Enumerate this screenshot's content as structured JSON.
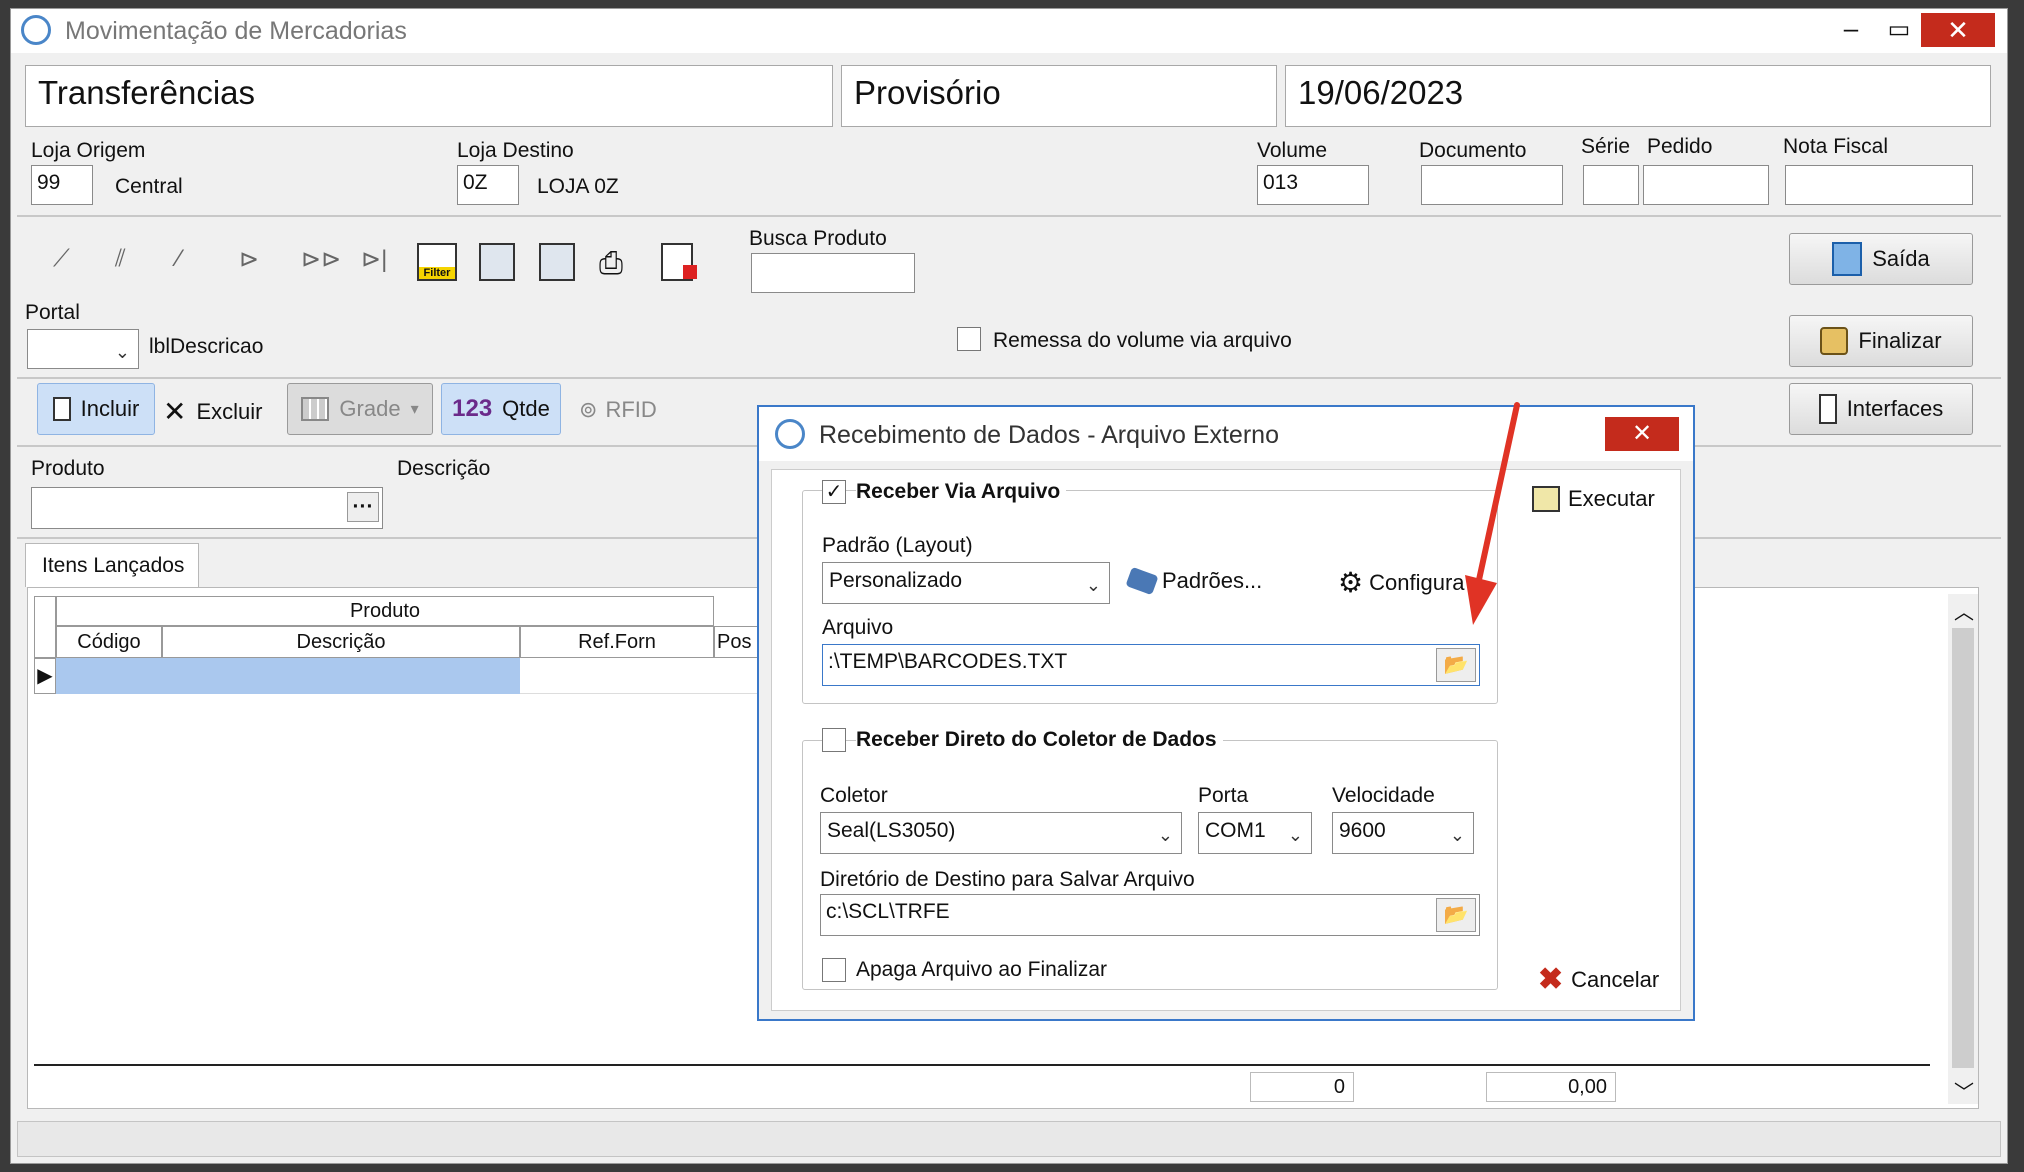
{
  "window": {
    "title": "Movimentação de Mercadorias"
  },
  "header": {
    "type": "Transferências",
    "status": "Provisório",
    "date": "19/06/2023"
  },
  "fields": {
    "loja_origem_label": "Loja Origem",
    "loja_origem_code": "99",
    "loja_origem_name": "Central",
    "loja_destino_label": "Loja Destino",
    "loja_destino_code": "0Z",
    "loja_destino_name": "LOJA 0Z",
    "volume_label": "Volume",
    "volume_value": "013",
    "documento_label": "Documento",
    "serie_label": "Série",
    "pedido_label": "Pedido",
    "nota_fiscal_label": "Nota Fiscal"
  },
  "toolbar": {
    "busca_label": "Busca Produto",
    "filter_text": "Filter"
  },
  "portal": {
    "label": "Portal",
    "descricao": "lblDescricao",
    "remessa_label": "Remessa do volume via arquivo"
  },
  "buttons": {
    "saida": "Saída",
    "finalizar": "Finalizar",
    "interfaces": "Interfaces"
  },
  "actions": {
    "incluir": "Incluir",
    "excluir": "Excluir",
    "grade": "Grade",
    "qtde_num": "123",
    "qtde": "Qtde",
    "rfid": "RFID"
  },
  "produto": {
    "label": "Produto",
    "descricao_label": "Descrição",
    "ellipsis": "···"
  },
  "tab": {
    "label": "Itens Lançados"
  },
  "grid": {
    "group_header": "Produto",
    "columns": [
      "Código",
      "Descrição",
      "Ref.Forn",
      "Pos"
    ],
    "footer_count": "0",
    "footer_total": "0,00"
  },
  "dialog": {
    "title": "Recebimento de Dados - Arquivo Externo",
    "receber_arquivo": "Receber Via Arquivo",
    "padrao_label": "Padrão (Layout)",
    "padrao_value": "Personalizado",
    "padroes_button": "Padrões...",
    "configura_button": "Configura",
    "arquivo_label": "Arquivo",
    "arquivo_value": ":\\TEMP\\BARCODES.TXT",
    "receber_coletor": "Receber Direto do Coletor de Dados",
    "coletor_label": "Coletor",
    "coletor_value": "Seal(LS3050)",
    "porta_label": "Porta",
    "porta_value": "COM1",
    "velocidade_label": "Velocidade",
    "velocidade_value": "9600",
    "diretorio_label": "Diretório de Destino para Salvar Arquivo",
    "diretorio_value": "c:\\SCL\\TRFE",
    "apaga_label": "Apaga Arquivo ao Finalizar",
    "executar": "Executar",
    "cancelar": "Cancelar"
  },
  "colors": {
    "accent": "#3a78c9",
    "close_red": "#c42b1c",
    "selection": "#aac8ee",
    "arrow": "#e03325"
  }
}
